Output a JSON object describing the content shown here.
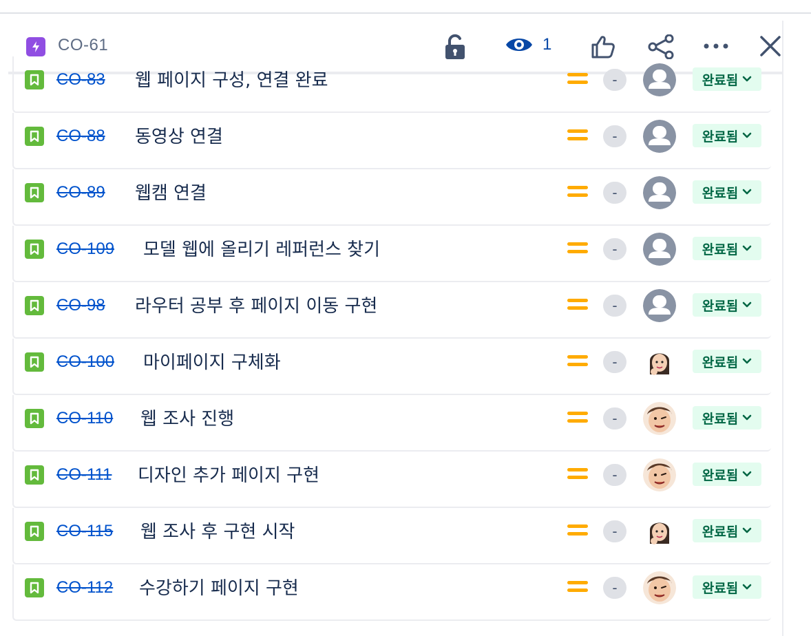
{
  "header": {
    "issue_key": "CO-61",
    "watch_count": "1",
    "icons": [
      "epic-lightning-icon",
      "unlock-icon",
      "eye-icon",
      "thumbs-up-icon",
      "share-icon",
      "more-icon",
      "close-icon"
    ]
  },
  "colors": {
    "epic": "#904ee2",
    "story": "#63ba3c",
    "link": "#0052cc",
    "priority_medium": "#ffab00",
    "status_bg": "#e3fcef",
    "status_text": "#006644"
  },
  "child_issues": [
    {
      "key": "CO-83",
      "summary": "웹 페이지 구성, 연결 완료",
      "estimate": "-",
      "status": "완료됨",
      "avatar": "default-avatar"
    },
    {
      "key": "CO-88",
      "summary": "동영상 연결",
      "estimate": "-",
      "status": "완료됨",
      "avatar": "default-avatar"
    },
    {
      "key": "CO-89",
      "summary": "웹캠 연결",
      "estimate": "-",
      "status": "완료됨",
      "avatar": "default-avatar"
    },
    {
      "key": "CO-109",
      "summary": "모델 웹에 올리기 레퍼런스 찾기",
      "estimate": "-",
      "status": "완료됨",
      "avatar": "default-avatar"
    },
    {
      "key": "CO-98",
      "summary": "라우터 공부 후 페이지 이동 구현",
      "estimate": "-",
      "status": "완료됨",
      "avatar": "default-avatar"
    },
    {
      "key": "CO-100",
      "summary": "마이페이지 구체화",
      "estimate": "-",
      "status": "완료됨",
      "avatar": "memoji-girl-avatar"
    },
    {
      "key": "CO-110",
      "summary": "웹 조사 진행",
      "estimate": "-",
      "status": "완료됨",
      "avatar": "memoji-boy-avatar"
    },
    {
      "key": "CO-111",
      "summary": "디자인 추가 페이지 구현",
      "estimate": "-",
      "status": "완료됨",
      "avatar": "memoji-boy-avatar"
    },
    {
      "key": "CO-115",
      "summary": "웹 조사 후 구현 시작",
      "estimate": "-",
      "status": "완료됨",
      "avatar": "memoji-girl-avatar"
    },
    {
      "key": "CO-112",
      "summary": "수강하기 페이지 구현",
      "estimate": "-",
      "status": "완료됨",
      "avatar": "memoji-boy-avatar"
    }
  ]
}
